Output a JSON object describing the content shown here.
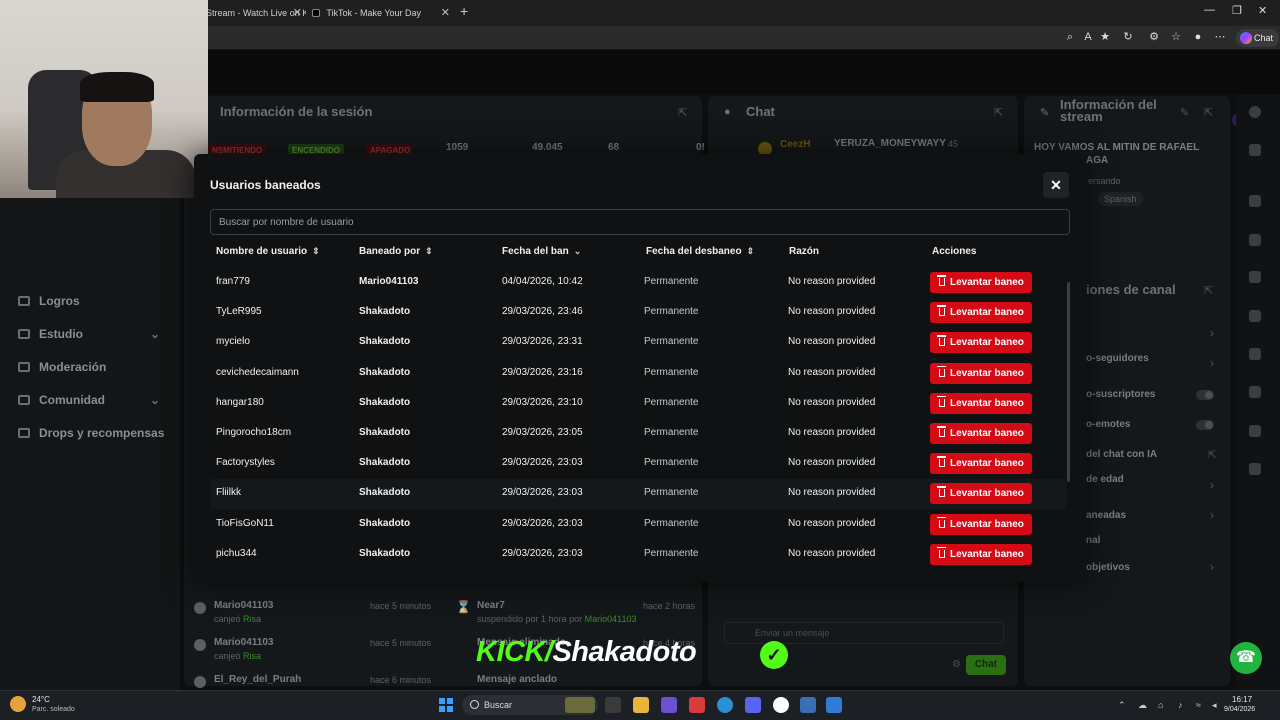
{
  "browser": {
    "tabs": [
      {
        "title": "Stream - Watch Live on K"
      },
      {
        "title": "TikTok - Make Your Day"
      }
    ],
    "chat_button": "Chat"
  },
  "sidebar": {
    "items": [
      {
        "label": "Logros",
        "icon": "trophy-icon",
        "expandable": false
      },
      {
        "label": "Estudio",
        "icon": "studio-icon",
        "expandable": true
      },
      {
        "label": "Moderación",
        "icon": "shield-icon",
        "expandable": false
      },
      {
        "label": "Comunidad",
        "icon": "community-icon",
        "expandable": true
      },
      {
        "label": "Drops y recompensas",
        "icon": "gift-icon",
        "expandable": false
      }
    ]
  },
  "session_panel": {
    "title": "Información de la sesión",
    "badges": [
      "NSMITIENDO",
      "ENCENDIDO",
      "APAGADO"
    ],
    "stats": [
      "1059",
      "49.045",
      "68",
      "0!"
    ]
  },
  "chat_panel": {
    "title": "Chat",
    "first_user": "CeezH",
    "first_message": "YERUZA_MONEYWAYY",
    "first_count": "45",
    "input_placeholder": "Enviar un mensaje",
    "send_label": "Chat"
  },
  "stream_info": {
    "title": "Información del stream",
    "stream_title": "HOY VAMOS AL MITIN DE RAFAEL",
    "stream_title_2": "AGA",
    "category": "ersando",
    "language": "Spanish"
  },
  "channel_panel": {
    "title": "iones de canal",
    "items": [
      "o-seguidores",
      "o-suscriptores",
      "o-emotes",
      "del chat con IA",
      "de edad",
      "aneadas",
      "nal",
      "objetivos"
    ]
  },
  "activity": {
    "left": [
      {
        "user": "Mario041103",
        "time": "hace 5 minutos",
        "action": "canjeó",
        "reward": "Risa"
      },
      {
        "user": "Mario041103",
        "time": "hace 5 minutos",
        "action": "canjeó",
        "reward": "Risa"
      },
      {
        "user": "El_Rey_del_Purah",
        "time": "hace 6 minutos",
        "action": "",
        "reward": ""
      }
    ],
    "middle": [
      {
        "user": "Near7",
        "time": "hace 2 horas",
        "action": "suspendido por 1 hora por",
        "by": "Mario041103"
      },
      {
        "user": "Mensaje eliminado",
        "time": "hace 4 horas",
        "action": "",
        "by": ""
      },
      {
        "user": "Mensaje anclado",
        "time": "",
        "action": "",
        "by": ""
      }
    ]
  },
  "modal": {
    "title": "Usuarios baneados",
    "search_placeholder": "Buscar por nombre de usuario",
    "columns": [
      "Nombre de usuario",
      "Baneado por",
      "Fecha del ban",
      "Fecha del desbaneo",
      "Razón",
      "Acciones"
    ],
    "unban_label": "Levantar baneo",
    "rows": [
      {
        "user": "fran779",
        "by": "Mario041103",
        "ban_date": "04/04/2026, 10:42",
        "unban_date": "Permanente",
        "reason": "No reason provided"
      },
      {
        "user": "TyLeR995",
        "by": "Shakadoto",
        "ban_date": "29/03/2026, 23:46",
        "unban_date": "Permanente",
        "reason": "No reason provided"
      },
      {
        "user": "mycielo",
        "by": "Shakadoto",
        "ban_date": "29/03/2026, 23:31",
        "unban_date": "Permanente",
        "reason": "No reason provided"
      },
      {
        "user": "cevichedecaimann",
        "by": "Shakadoto",
        "ban_date": "29/03/2026, 23:16",
        "unban_date": "Permanente",
        "reason": "No reason provided"
      },
      {
        "user": "hangar180",
        "by": "Shakadoto",
        "ban_date": "29/03/2026, 23:10",
        "unban_date": "Permanente",
        "reason": "No reason provided"
      },
      {
        "user": "Pingorocho18cm",
        "by": "Shakadoto",
        "ban_date": "29/03/2026, 23:05",
        "unban_date": "Permanente",
        "reason": "No reason provided"
      },
      {
        "user": "Factorystyles",
        "by": "Shakadoto",
        "ban_date": "29/03/2026, 23:03",
        "unban_date": "Permanente",
        "reason": "No reason provided"
      },
      {
        "user": "Fliilkk",
        "by": "Shakadoto",
        "ban_date": "29/03/2026, 23:03",
        "unban_date": "Permanente",
        "reason": "No reason provided"
      },
      {
        "user": "TioFisGoN11",
        "by": "Shakadoto",
        "ban_date": "29/03/2026, 23:03",
        "unban_date": "Permanente",
        "reason": "No reason provided"
      },
      {
        "user": "pichu344",
        "by": "Shakadoto",
        "ban_date": "29/03/2026, 23:03",
        "unban_date": "Permanente",
        "reason": "No reason provided"
      }
    ]
  },
  "overlay": {
    "brand_prefix": "KICK/",
    "brand_name": "Shakadoto"
  },
  "taskbar": {
    "weather_temp": "24°C",
    "weather_desc": "Parc. soleado",
    "search_label": "Buscar",
    "time": "16:17",
    "date": "9/04/2026"
  },
  "colors": {
    "accent_green": "#53fc18",
    "danger_red": "#d40a15",
    "modal_bg": "#0f1112"
  }
}
